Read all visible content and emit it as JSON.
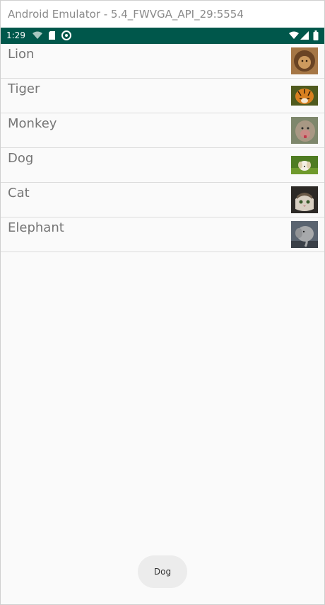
{
  "window": {
    "title": "Android Emulator - 5.4_FWVGA_API_29:5554"
  },
  "status_bar": {
    "time": "1:29",
    "left_icons": [
      "wifi-icon",
      "sd-card-icon",
      "sync-icon"
    ],
    "right_icons": [
      "wifi-signal-icon",
      "cell-signal-icon",
      "battery-icon"
    ]
  },
  "list": {
    "items": [
      {
        "label": "Lion",
        "image": "lion-image"
      },
      {
        "label": "Tiger",
        "image": "tiger-image"
      },
      {
        "label": "Monkey",
        "image": "monkey-image"
      },
      {
        "label": "Dog",
        "image": "dog-image"
      },
      {
        "label": "Cat",
        "image": "cat-image"
      },
      {
        "label": "Elephant",
        "image": "elephant-image"
      }
    ]
  },
  "toast": {
    "text": "Dog"
  },
  "colors": {
    "status_bar": "#00574b",
    "divider": "#dcdcdc",
    "label": "#757575",
    "toast_bg": "#ececec"
  }
}
